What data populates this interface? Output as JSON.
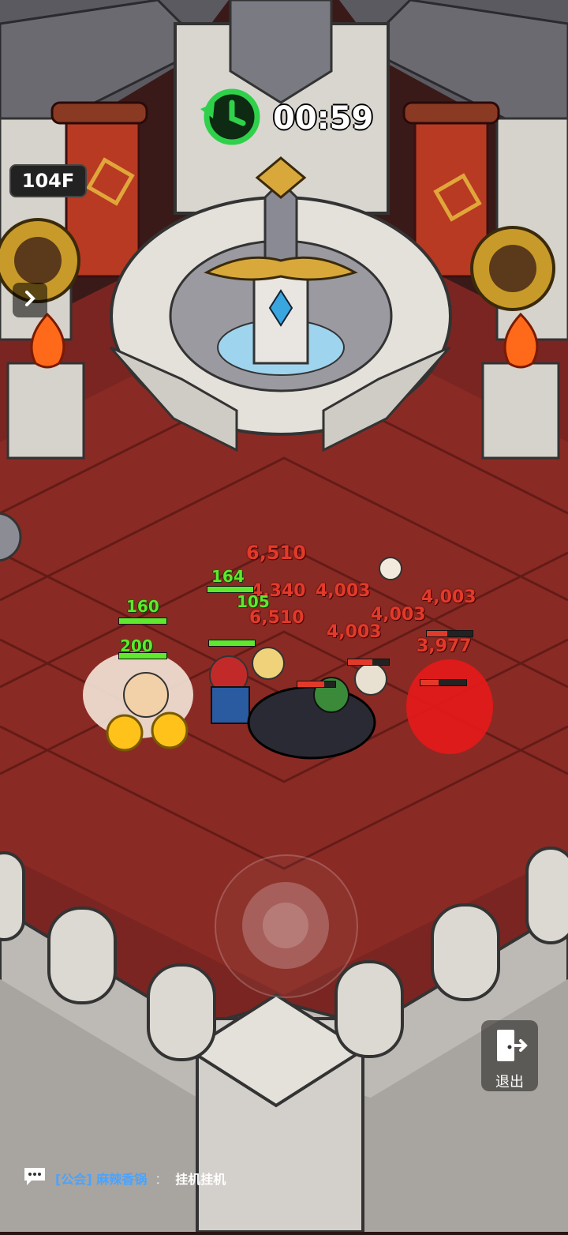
{
  "hud": {
    "timer": "00:59",
    "floor": "104F",
    "exit_label": "退出"
  },
  "chat": {
    "channel": "[公会] 麻辣香锅",
    "separator": "：",
    "message": "挂机挂机"
  },
  "combat_text": {
    "damage": [
      "6,510",
      "4,340",
      "4,003",
      "6,510",
      "4,003",
      "4,003",
      "4,003",
      "3,977"
    ],
    "heal": [
      "160",
      "164",
      "200",
      "105"
    ]
  },
  "colors": {
    "damage": "#e23a2a",
    "heal": "#5fe82d",
    "timer_icon": "#2fd14a"
  }
}
